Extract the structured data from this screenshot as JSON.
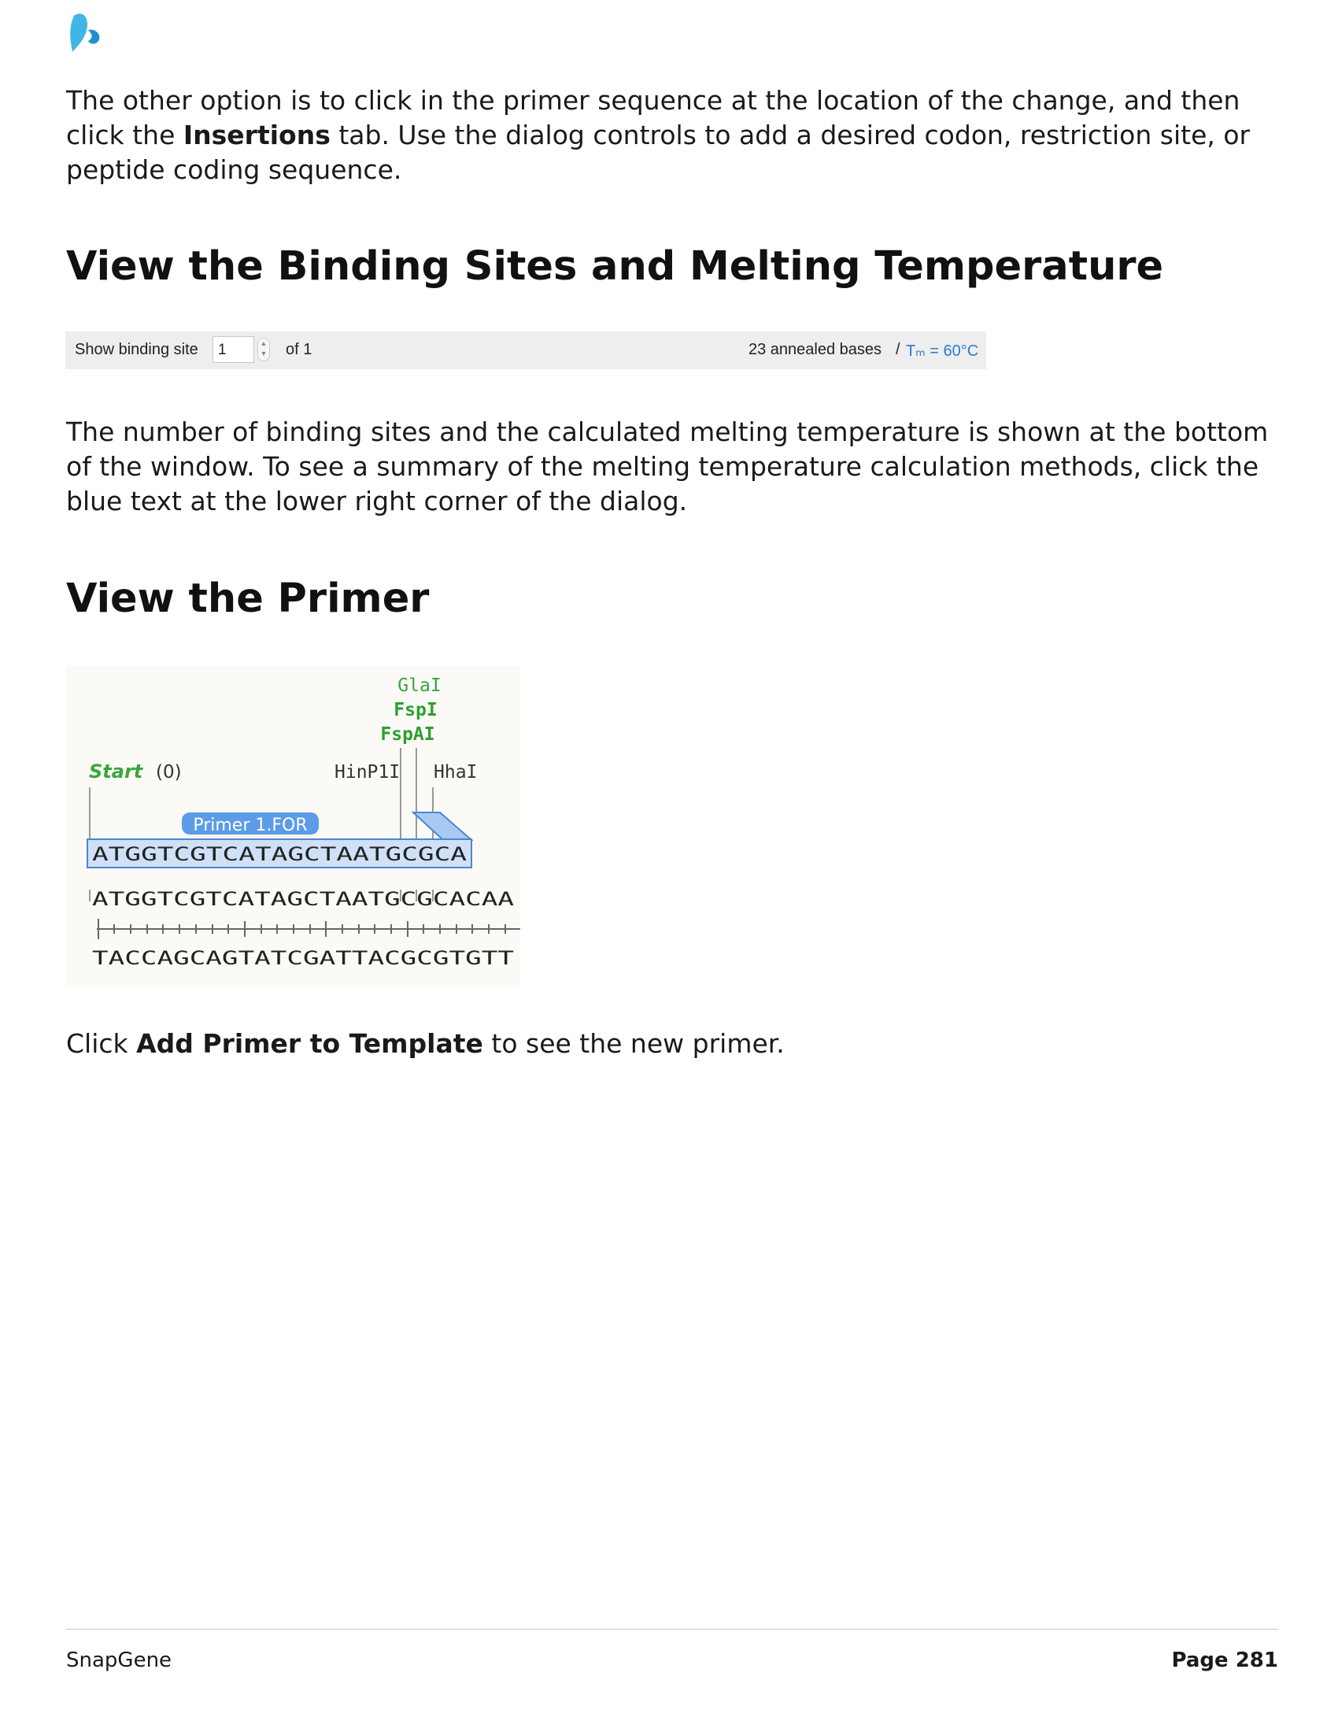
{
  "para1": {
    "pre": "The other option is to click in the primer sequence at the location of the change, and then click the ",
    "bold": "Insertions",
    "post": " tab. Use the dialog controls to add a desired codon, restriction site, or peptide coding sequence."
  },
  "heading1": "View the Binding Sites and Melting Temperature",
  "binding_bar": {
    "label": "Show binding site",
    "value": "1",
    "of_text": "of 1",
    "annealed": "23 annealed bases",
    "separator": "/",
    "tm": "Tₘ = 60°C"
  },
  "para2": "The number of binding sites and the calculated melting temperature is shown at the bottom of the window. To see a summary of the melting temperature calculation methods, click the blue text at the lower right corner of the dialog.",
  "heading2": "View the Primer",
  "primer_figure": {
    "enzymes_stacked": [
      "GlaI",
      "FspI",
      "FspAI"
    ],
    "start_label": "Start",
    "start_pos": "(0)",
    "enzyme_hinp1i": "HinP1I",
    "enzyme_hhai": "HhaI",
    "primer_name": "Primer 1.FOR",
    "primer_seq": "ATGGTCGTCATAGCTAATGCGCA",
    "top_strand": "ATGGTCGTCATAGCTAATGCGCACAA",
    "bottom_strand": "TACCAGCAGTATCGATTACGCGTGTT"
  },
  "para3": {
    "pre": "Click ",
    "bold": "Add Primer to Template",
    "post": " to see the new primer."
  },
  "footer": {
    "left": "SnapGene",
    "right": "Page 281"
  },
  "colors": {
    "enzyme_green": "#3aa63a",
    "primer_blue": "#5b9be8",
    "tm_blue": "#2a7ad6"
  }
}
